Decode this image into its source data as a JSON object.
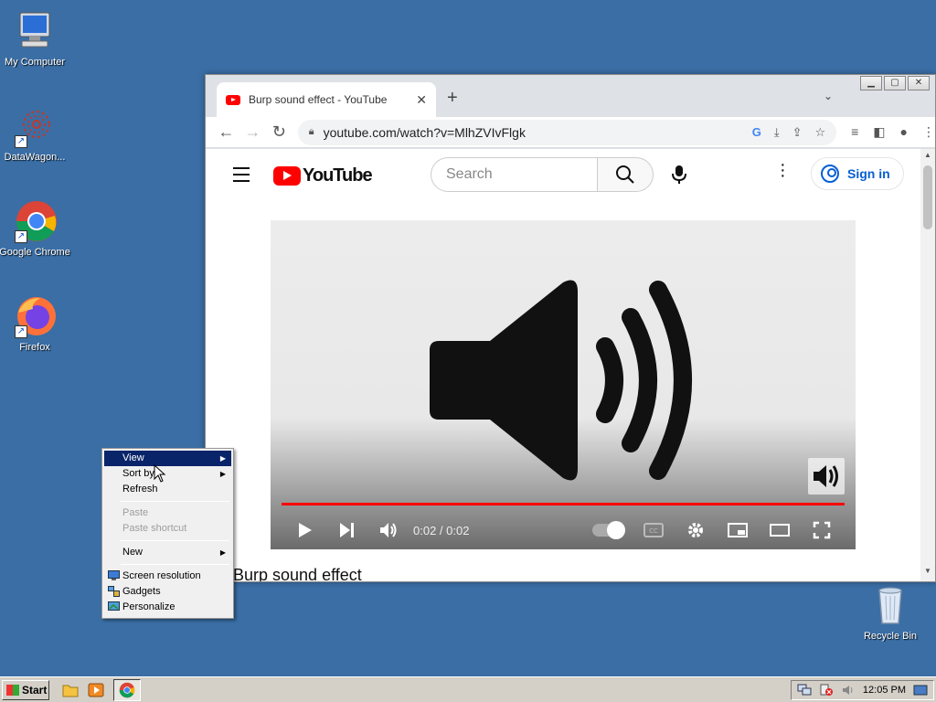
{
  "desktop": {
    "icons": [
      {
        "label": "My Computer"
      },
      {
        "label": "DataWagon..."
      },
      {
        "label": "Google Chrome"
      },
      {
        "label": "Firefox"
      },
      {
        "label": "Recycle Bin"
      }
    ]
  },
  "browser": {
    "tab_title": "Burp sound effect - YouTube",
    "tab_close": "✕",
    "new_tab": "+",
    "tab_menu": "⌄",
    "url": "youtube.com/watch?v=MlhZVIvFlgk",
    "window_controls": [
      "▁",
      "▢",
      "✕"
    ]
  },
  "youtube": {
    "logo_text": "YouTube",
    "search_placeholder": "Search",
    "sign_in": "Sign in",
    "player": {
      "time": "0:02 / 0:02",
      "progress": 1.0
    },
    "video_title": "Burp sound effect"
  },
  "context_menu": {
    "items": [
      {
        "label": "View",
        "submenu": true,
        "highlighted": true
      },
      {
        "label": "Sort by",
        "submenu": true
      },
      {
        "label": "Refresh"
      },
      {
        "label": "Paste",
        "disabled": true
      },
      {
        "label": "Paste shortcut",
        "disabled": true
      },
      {
        "label": "New",
        "submenu": true
      },
      {
        "label": "Screen resolution"
      },
      {
        "label": "Gadgets"
      },
      {
        "label": "Personalize"
      }
    ],
    "arrow": "▶"
  },
  "taskbar": {
    "start_label": "Start",
    "clock": "12:05 PM"
  },
  "colors": {
    "desktop_bg": "#3a6ea5",
    "youtube_red": "#ff0000",
    "link_blue": "#065fd4",
    "menu_highlight": "#0a246a"
  }
}
